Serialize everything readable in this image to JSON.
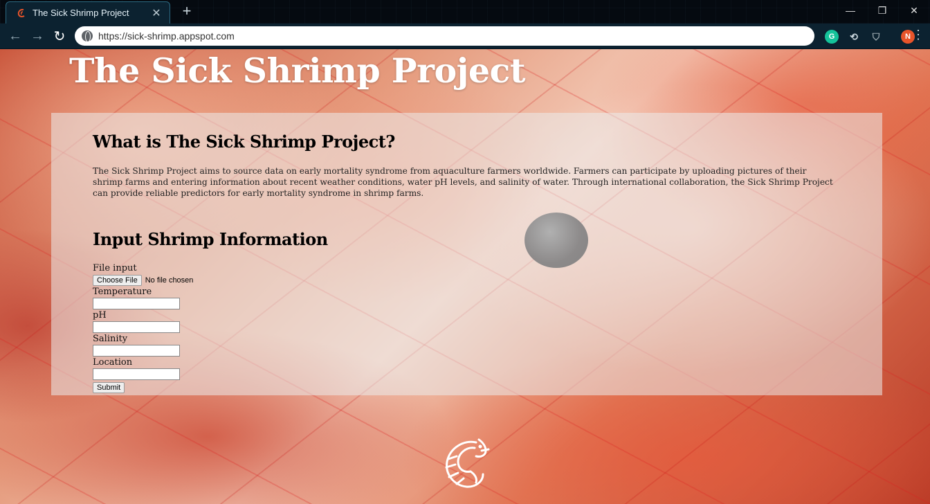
{
  "browser": {
    "tab_title": "The Sick Shrimp Project",
    "tab_close": "✕",
    "new_tab": "+",
    "url": "https://sick-shrimp.appspot.com",
    "profile_initial": "N",
    "window_controls": {
      "minimize": "—",
      "restore": "❐",
      "close": "✕"
    },
    "nav": {
      "back": "←",
      "forward": "→",
      "reload": "↻"
    }
  },
  "page": {
    "site_title": "The Sick Shrimp Project",
    "about": {
      "heading": "What is The Sick Shrimp Project?",
      "text": "The Sick Shrimp Project aims to source data on early mortality syndrome from aquaculture farmers worldwide. Farmers can participate by uploading pictures of their shrimp farms and entering information about recent weather conditions, water pH levels, and salinity of water. Through international collaboration, the Sick Shrimp Project can provide reliable predictors for early mortality syndrome in shrimp farms."
    },
    "form": {
      "heading": "Input Shrimp Information",
      "file_label": "File input",
      "file_button": "Choose File",
      "file_status": "No file chosen",
      "temperature_label": "Temperature",
      "ph_label": "pH",
      "salinity_label": "Salinity",
      "location_label": "Location",
      "submit_label": "Submit"
    }
  },
  "colors": {
    "chrome_bg": "#0c2230",
    "panel_bg": "rgba(235,235,235,0.55)",
    "ext_grammarly": "#15c39a",
    "ext_profile": "#e8542a"
  }
}
